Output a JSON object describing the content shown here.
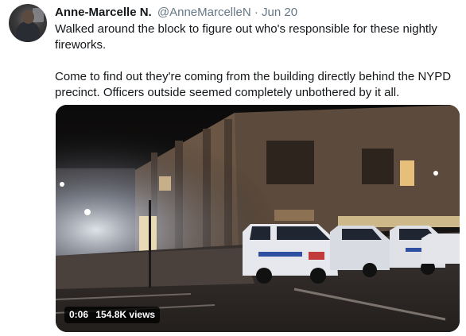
{
  "tweet": {
    "author_name": "Anne-Marcelle N.",
    "handle": "@AnneMarcelleN",
    "separator": "·",
    "date": "Jun 20",
    "paragraphs": [
      "Walked around the block to figure out who's responsible for these nightly fireworks.",
      "Come to find out they're coming from the building directly behind the NYPD precinct. Officers outside seemed completely unbothered by it all."
    ],
    "video": {
      "duration": "0:06",
      "views": "154.8K views"
    }
  }
}
